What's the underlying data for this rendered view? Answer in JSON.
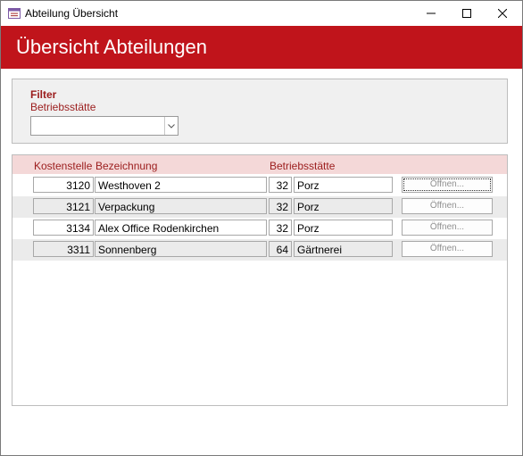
{
  "window": {
    "title": "Abteilung Übersicht",
    "controls": [
      "minimize",
      "maximize",
      "close"
    ]
  },
  "header": {
    "title": "Übersicht Abteilungen"
  },
  "filter": {
    "heading": "Filter",
    "label": "Betriebsstätte",
    "value": ""
  },
  "list": {
    "columns": [
      "Kostenstelle",
      "Bezeichnung",
      "Betriebsstätte"
    ],
    "rows": [
      {
        "kostenstelle": "3120",
        "bezeichnung": "Westhoven 2",
        "bs_nr": "32",
        "bs_name": "Porz",
        "button": "Öffnen..."
      },
      {
        "kostenstelle": "3121",
        "bezeichnung": "Verpackung",
        "bs_nr": "32",
        "bs_name": "Porz",
        "button": "Öffnen..."
      },
      {
        "kostenstelle": "3134",
        "bezeichnung": "Alex Office Rodenkirchen",
        "bs_nr": "32",
        "bs_name": "Porz",
        "button": "Öffnen..."
      },
      {
        "kostenstelle": "3311",
        "bezeichnung": "Sonnenberg",
        "bs_nr": "64",
        "bs_name": "Gärtnerei",
        "button": "Öffnen..."
      }
    ]
  },
  "colors": {
    "accent": "#c0141b",
    "label": "#9b1c1c",
    "header_row": "#f4d8d8"
  }
}
